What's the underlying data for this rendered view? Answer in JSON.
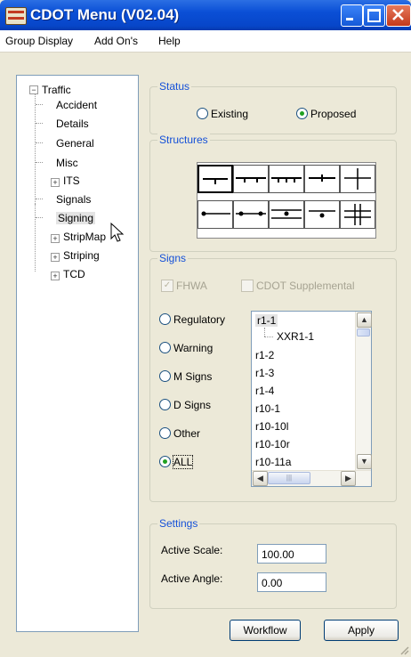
{
  "window": {
    "title": "CDOT Menu (V02.04)"
  },
  "menu": [
    "Group Display",
    "Add On's",
    "Help"
  ],
  "tree": {
    "root": "Traffic",
    "children": [
      "Accident",
      "Details",
      "General",
      "Misc",
      "ITS",
      "Signals",
      "Signing",
      "StripMap",
      "Striping",
      "TCD"
    ],
    "selected": "Signing"
  },
  "status": {
    "label": "Status",
    "existing": "Existing",
    "proposed": "Proposed",
    "selected": "Proposed"
  },
  "structures": {
    "label": "Structures"
  },
  "signs": {
    "label": "Signs",
    "fhwa": "FHWA",
    "cdot_supplemental": "CDOT Supplemental",
    "types": [
      "Regulatory",
      "Warning",
      "M Signs",
      "D Signs",
      "Other",
      "ALL"
    ],
    "selected_type": "ALL",
    "list": [
      "r1-1",
      "XXR1-1",
      "r1-2",
      "r1-3",
      "r1-4",
      "r10-1",
      "r10-10l",
      "r10-10r",
      "r10-11a"
    ]
  },
  "settings": {
    "label": "Settings",
    "active_scale_label": "Active Scale:",
    "active_scale": "100.00",
    "active_angle_label": "Active Angle:",
    "active_angle": "0.00"
  },
  "buttons": {
    "workflow": "Workflow",
    "apply": "Apply"
  },
  "colors": {
    "titlebar": "#0a4fd6",
    "group_label": "#1450d8",
    "radio_dot": "#21a121"
  }
}
